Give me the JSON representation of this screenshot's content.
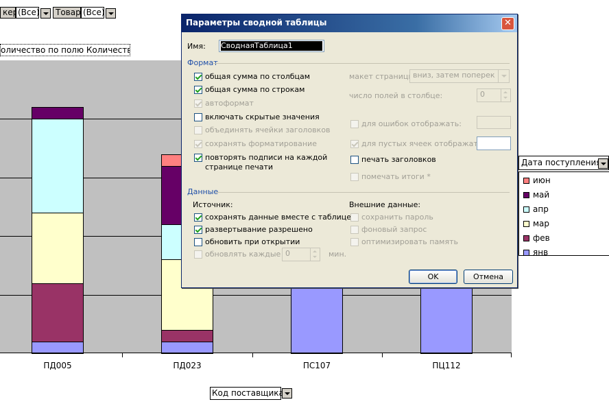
{
  "page_fields": {
    "field1_label": "кер",
    "field1_value": "(Все)",
    "field2_label": "Товар",
    "field2_value": "(Все)"
  },
  "data_field": "оличество по полю Количество",
  "category_field": "Код поставщика",
  "legend": {
    "title": "Дата поступления",
    "items": [
      {
        "label": "июн",
        "color": "#ff8080"
      },
      {
        "label": "май",
        "color": "#660066"
      },
      {
        "label": "апр",
        "color": "#ccffff"
      },
      {
        "label": "мар",
        "color": "#ffffcc"
      },
      {
        "label": "фев",
        "color": "#993366"
      },
      {
        "label": "янв",
        "color": "#9999ff"
      }
    ]
  },
  "chart_data": {
    "type": "bar",
    "stacked": true,
    "categories": [
      "ПД005",
      "ПД023",
      "ПС107",
      "ПЦ112"
    ],
    "series": [
      {
        "name": "янв",
        "values": [
          0.2,
          0.2,
          4.0,
          4.0
        ]
      },
      {
        "name": "фев",
        "values": [
          1.0,
          0.2,
          0,
          0
        ]
      },
      {
        "name": "мар",
        "values": [
          1.2,
          1.2,
          0,
          0
        ]
      },
      {
        "name": "апр",
        "values": [
          1.6,
          0.6,
          0,
          0
        ]
      },
      {
        "name": "май",
        "values": [
          0.2,
          1.0,
          0,
          0
        ]
      },
      {
        "name": "июн",
        "values": [
          0,
          0.2,
          0,
          0
        ]
      }
    ],
    "ylim": [
      0,
      5
    ],
    "grid": true
  },
  "dialog": {
    "title": "Параметры сводной таблицы",
    "name_label": "Имя:",
    "name_value": "СводнаяТаблица1",
    "format_section": "Формат",
    "cb_grand_cols": "общая сумма по столбцам",
    "cb_grand_rows": "общая сумма по строкам",
    "cb_autoformat": "автоформат",
    "cb_hidden": "включать скрытые значения",
    "cb_merge": "объединять ячейки заголовков",
    "cb_preserve": "сохранять форматирование",
    "cb_repeat_1": "повторять подписи на каждой",
    "cb_repeat_2": "странице печати",
    "page_layout_label": "макет страницы:",
    "page_layout_value": "вниз, затем поперек",
    "fields_per_col_label": "число полей в столбце:",
    "fields_per_col_value": "0",
    "cb_errors": "для ошибок отображать:",
    "cb_empty": "для пустых ячеек отображать:",
    "cb_print_titles": "печать заголовков",
    "cb_mark_totals": "помечать итоги *",
    "data_section": "Данные",
    "source_label": "Источник:",
    "cb_save_data": "сохранять данные вместе с таблицей",
    "cb_drilldown": "развертывание разрешено",
    "cb_refresh_open": "обновить при открытии",
    "cb_refresh_every": "обновлять каждые",
    "refresh_value": "0",
    "minutes": "мин.",
    "external_label": "Внешние данные:",
    "cb_save_password": "сохранить пароль",
    "cb_background": "фоновый запрос",
    "cb_optimize": "оптимизировать память",
    "ok": "OK",
    "cancel": "Отмена"
  }
}
